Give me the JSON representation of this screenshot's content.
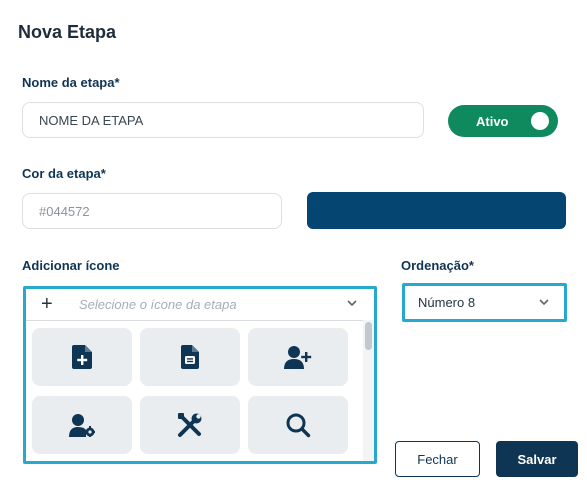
{
  "modal": {
    "title": "Nova Etapa"
  },
  "stage_name": {
    "label": "Nome da etapa*",
    "value": "NOME DA ETAPA"
  },
  "status_toggle": {
    "label": "Ativo",
    "on": true,
    "color": "#0f8a5f"
  },
  "stage_color": {
    "label": "Cor da etapa*",
    "value": "#044572",
    "swatch": "#044572"
  },
  "icon_picker": {
    "label": "Adicionar ícone",
    "placeholder": "Selecione o ícone da etapa",
    "icons": [
      "file-plus-icon",
      "document-icon",
      "user-plus-icon",
      "user-gear-icon",
      "tools-icon",
      "search-icon"
    ]
  },
  "ordering": {
    "label": "Ordenação*",
    "value": "Número 8"
  },
  "footer": {
    "close_label": "Fechar",
    "save_label": "Salvar"
  },
  "colors": {
    "primary": "#0f3554",
    "accent": "#27a9cf",
    "success": "#0f8a5f",
    "tile": "#e9edef"
  }
}
